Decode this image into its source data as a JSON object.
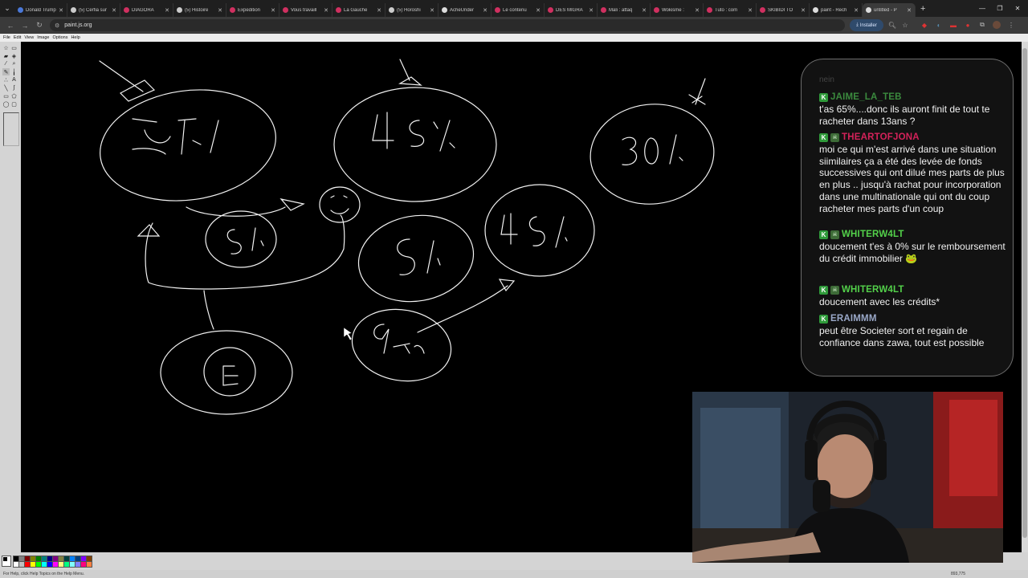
{
  "browser": {
    "tabs": [
      {
        "title": "Donald Trump",
        "color": "#4a78d8"
      },
      {
        "title": "(5) Cerfia sur",
        "color": "#cccccc"
      },
      {
        "title": "DIAGORA",
        "color": "#d03060"
      },
      {
        "title": "(5) Histoire",
        "color": "#cccccc"
      },
      {
        "title": "Expedition",
        "color": "#d03060"
      },
      {
        "title": "Vous travaill",
        "color": "#d03060"
      },
      {
        "title": "La Gauche",
        "color": "#d03060"
      },
      {
        "title": "(5) Horoshi",
        "color": "#cccccc"
      },
      {
        "title": "AcheUnder",
        "color": "#dddddd"
      },
      {
        "title": "Le contenu",
        "color": "#d03060"
      },
      {
        "title": "DES MIGRA",
        "color": "#d03060"
      },
      {
        "title": "Mali : attaq",
        "color": "#d03060"
      },
      {
        "title": "Wokisme :",
        "color": "#d03060"
      },
      {
        "title": "Tuto : com",
        "color": "#d03060"
      },
      {
        "title": "SKIBIDI TO",
        "color": "#d03060"
      },
      {
        "title": "paint - Rech",
        "color": "#dddddd"
      },
      {
        "title": "untitled - P",
        "color": "#dddddd"
      }
    ],
    "new_tab_symbol": "+",
    "url": "paint.js.org",
    "install_label": "Installer"
  },
  "paint": {
    "menu": [
      "File",
      "Edit",
      "View",
      "Image",
      "Options",
      "Help"
    ],
    "status_help": "For Help, click Help Topics on the Help Menu.",
    "status_position": "893,775",
    "palette_colors": [
      "#000000",
      "#808080",
      "#800000",
      "#808000",
      "#008000",
      "#008080",
      "#000080",
      "#800080",
      "#808040",
      "#004040",
      "#0080ff",
      "#004080",
      "#8000ff",
      "#804000",
      "#ffffff",
      "#c0c0c0",
      "#ff0000",
      "#ffff00",
      "#00ff00",
      "#00ffff",
      "#0000ff",
      "#ff00ff",
      "#ffff80",
      "#00ff80",
      "#80ffff",
      "#8080ff",
      "#ff0080",
      "#ff8040"
    ],
    "drawing_texts": [
      "25%",
      "45%",
      "30%",
      "5%",
      "5%",
      "45%",
      "9 ans",
      "E"
    ]
  },
  "chat": {
    "faded_text": "nein",
    "messages": [
      {
        "user": "JAIME_LA_TEB",
        "color": "#3b8a3e",
        "badges": [
          "K"
        ],
        "text": "t'as 65%....donc ils auront finit de tout te racheter dans 13ans ?"
      },
      {
        "user": "THEARTOFJONA",
        "color": "#d4225a",
        "badges": [
          "K",
          "skull"
        ],
        "text": "moi ce qui m'est arrivé dans une situation siimilaires ça a été des levée de fonds successives qui ont dilué mes parts de plus en plus .. jusqu'à rachat pour incorporation dans une multinationale qui ont du coup racheter mes parts d'un coup"
      },
      {
        "user": "WHITERW4LT",
        "color": "#53d14a",
        "badges": [
          "K",
          "skull"
        ],
        "text": "doucement t'es à 0% sur le remboursement du crédit immobilier 🐸"
      },
      {
        "user": "WHITERW4LT",
        "color": "#53d14a",
        "badges": [
          "K",
          "skull"
        ],
        "text": "doucement avec les crédits*"
      },
      {
        "user": "ERAIMMM",
        "color": "#9aa8c8",
        "badges": [
          "K"
        ],
        "text": "peut être Societer sort et regain de confiance dans zawa, tout est possible"
      }
    ]
  },
  "icons": [
    "menu-icon",
    "close-icon",
    "plus-icon",
    "back-icon",
    "forward-icon",
    "reload-icon",
    "site-info-icon",
    "install-icon",
    "zoom-icon",
    "bookmark-star-icon",
    "extension-icon",
    "profile-icon",
    "kebab-menu-icon",
    "pencil-icon",
    "brush-icon",
    "text-icon",
    "eraser-icon",
    "fill-icon",
    "select-icon",
    "skull-icon",
    "webcam-person"
  ]
}
